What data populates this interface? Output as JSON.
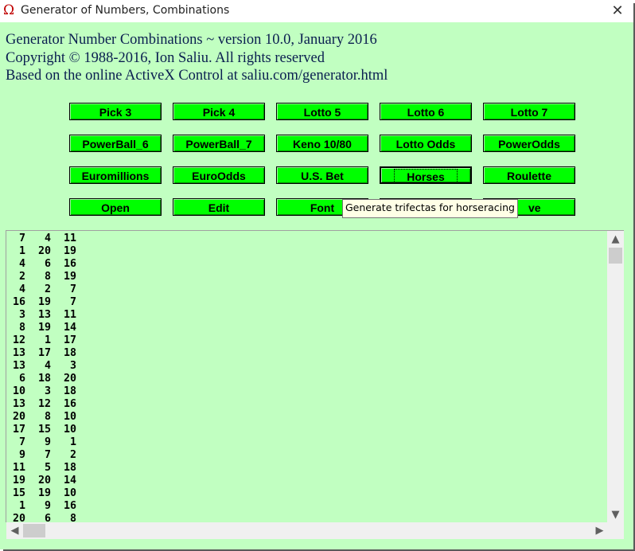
{
  "window": {
    "title": "Generator of Numbers, Combinations",
    "app_icon": "horseshoe-magnet-icon",
    "close_glyph": "✕",
    "background_color": "#c1ffc1"
  },
  "header": {
    "line1": "Generator Number Combinations ~ version 10.0, January 2016",
    "line2": "Copyright © 1988-2016, Ion Saliu. All rights reserved",
    "line3": "Based on the online ActiveX Control at saliu.com/generator.html"
  },
  "buttons": {
    "color": "#00ff00",
    "pick3": "Pick 3",
    "pick4": "Pick 4",
    "lotto5": "Lotto 5",
    "lotto6": "Lotto 6",
    "lotto7": "Lotto 7",
    "powerball6": "PowerBall_6",
    "powerball7": "PowerBall_7",
    "keno": "Keno 10/80",
    "lotto_odds": "Lotto Odds",
    "power_odds": "PowerOdds",
    "euromillions": "Euromillions",
    "euro_odds": "EuroOdds",
    "us_bet": "U.S. Bet",
    "horses": "Horses",
    "roulette": "Roulette",
    "open": "Open",
    "edit": "Edit",
    "font": "Font",
    "save_visible": "ve"
  },
  "tooltip": "Generate trifectas for horseracing",
  "output": {
    "rows": [
      "  7   4  11",
      "  1  20  19",
      "  4   6  16",
      "  2   8  19",
      "  4   2   7",
      " 16  19   7",
      "  3  13  11",
      "  8  19  14",
      " 12   1  17",
      " 13  17  18",
      " 13   4   3",
      "  6  18  20",
      " 10   3  18",
      " 13  12  16",
      " 20   8  10",
      " 17  15  10",
      "  7   9   1",
      "  9   7   2",
      " 11   5  18",
      " 19  20  14",
      " 15  19  10",
      "  1   9  16",
      " 20   6   8"
    ]
  },
  "scrollbars": {
    "up": "▲",
    "down": "▼",
    "left": "◀",
    "right": "▶"
  }
}
